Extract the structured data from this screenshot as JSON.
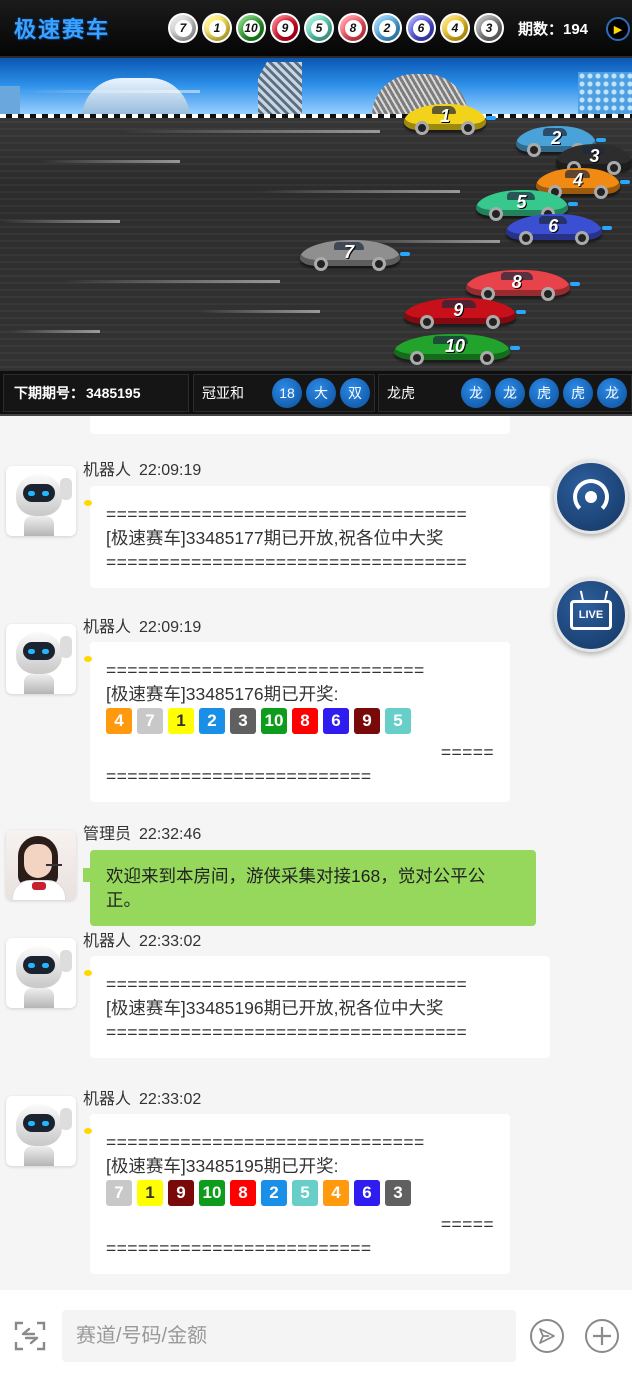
{
  "header": {
    "title": "极速赛车",
    "balls": [
      {
        "n": "7",
        "color": "#cfcfcf"
      },
      {
        "n": "1",
        "color": "#ffe54a"
      },
      {
        "n": "10",
        "color": "#1d9e1d"
      },
      {
        "n": "9",
        "color": "#e0001a"
      },
      {
        "n": "5",
        "color": "#56d3b8"
      },
      {
        "n": "8",
        "color": "#ff4a5a"
      },
      {
        "n": "2",
        "color": "#48a9ea"
      },
      {
        "n": "6",
        "color": "#4a4fe0"
      },
      {
        "n": "4",
        "color": "#f5c414"
      },
      {
        "n": "3",
        "color": "#7c7c7c"
      }
    ],
    "period_label": "期数：194",
    "sound_icon": "speaker-icon"
  },
  "race": {
    "cars": [
      {
        "num": "1",
        "color": "#f3d31a"
      },
      {
        "num": "2",
        "color": "#4aa3d8"
      },
      {
        "num": "3",
        "color": "#2d2d2d"
      },
      {
        "num": "4",
        "color": "#f08a13"
      },
      {
        "num": "5",
        "color": "#36c88c"
      },
      {
        "num": "6",
        "color": "#3b4fd2"
      },
      {
        "num": "7",
        "color": "#8f8f8f"
      },
      {
        "num": "8",
        "color": "#e8424a"
      },
      {
        "num": "9",
        "color": "#c8101a"
      },
      {
        "num": "10",
        "color": "#21a32c"
      }
    ]
  },
  "info": {
    "next_issue_label": "下期期号：",
    "next_issue_value": "3485195",
    "sum_label": "冠亚和",
    "sum_chips": [
      "18",
      "大",
      "双"
    ],
    "dragon_label": "龙虎",
    "dragon_chips": [
      "龙",
      "龙",
      "虎",
      "虎",
      "龙"
    ]
  },
  "chat": {
    "messages": [
      {
        "sender": "机器人",
        "time": "22:09:19",
        "sep_top": "==================================",
        "text": "[极速赛车]33485177期已开放,祝各位中大奖",
        "sep_bottom": "=================================="
      },
      {
        "sender": "机器人",
        "time": "22:09:19",
        "sep_top": "==============================",
        "text": "[极速赛车]33485176期已开奖:",
        "results": [
          {
            "n": "4",
            "color": "#ff9a0e"
          },
          {
            "n": "7",
            "color": "#c8c8c8"
          },
          {
            "n": "1",
            "color": "#ffff00",
            "dark": true
          },
          {
            "n": "2",
            "color": "#1a8fe8"
          },
          {
            "n": "3",
            "color": "#606060"
          },
          {
            "n": "10",
            "color": "#0d9c1c"
          },
          {
            "n": "8",
            "color": "#ff0000"
          },
          {
            "n": "6",
            "color": "#2e1cf0"
          },
          {
            "n": "9",
            "color": "#7a0a0a"
          },
          {
            "n": "5",
            "color": "#68cfc8"
          }
        ],
        "sep_right": "=====",
        "sep_bottom": "========================="
      },
      {
        "sender": "管理员",
        "time": "22:32:46",
        "text": "欢迎来到本房间，游侠采集对接168，觉对公平公正。"
      },
      {
        "sender": "机器人",
        "time": "22:33:02",
        "sep_top": "==================================",
        "text": "[极速赛车]33485196期已开放,祝各位中大奖",
        "sep_bottom": "=================================="
      },
      {
        "sender": "机器人",
        "time": "22:33:02",
        "sep_top": "==============================",
        "text": "[极速赛车]33485195期已开奖:",
        "results": [
          {
            "n": "7",
            "color": "#c8c8c8"
          },
          {
            "n": "1",
            "color": "#ffff00",
            "dark": true
          },
          {
            "n": "9",
            "color": "#7a0a0a"
          },
          {
            "n": "10",
            "color": "#0d9c1c"
          },
          {
            "n": "8",
            "color": "#ff0000"
          },
          {
            "n": "2",
            "color": "#1a8fe8"
          },
          {
            "n": "5",
            "color": "#68cfc8"
          },
          {
            "n": "4",
            "color": "#ff9a0e"
          },
          {
            "n": "6",
            "color": "#2e1cf0"
          },
          {
            "n": "3",
            "color": "#606060"
          }
        ],
        "sep_right": "=====",
        "sep_bottom": "========================="
      }
    ],
    "float_buttons": [
      {
        "icon": "customer-service-headset-icon"
      },
      {
        "icon": "live-tv-icon",
        "label": "LIVE"
      }
    ]
  },
  "input_bar": {
    "placeholder": "赛道/号码/金额",
    "toggle_icon": "switch-keyboard-icon",
    "send_icon": "send-icon",
    "plus_icon": "plus-icon"
  }
}
